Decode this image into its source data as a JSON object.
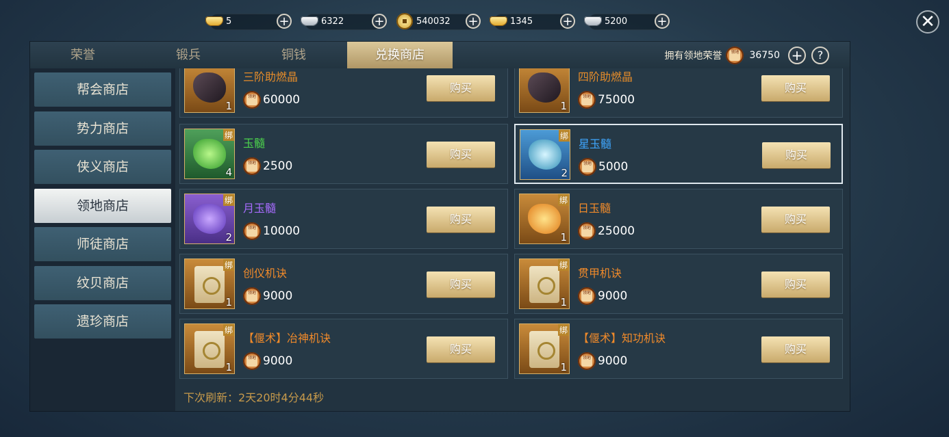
{
  "currencies": [
    {
      "icon": "gold-ingot-icon",
      "value": "5"
    },
    {
      "icon": "silver-ingot-icon",
      "value": "6322"
    },
    {
      "icon": "copper-coin-icon",
      "value": "540032"
    },
    {
      "icon": "bound-gold-ingot-icon",
      "value": "1345"
    },
    {
      "icon": "bound-silver-ingot-icon",
      "value": "5200"
    }
  ],
  "close_label": "✕",
  "tabs": [
    "荣誉",
    "锻兵",
    "铜钱",
    "兑换商店"
  ],
  "active_tab": 3,
  "honor": {
    "label": "拥有领地荣誉",
    "token_text": "领地",
    "value": "36750",
    "plus": "+",
    "help": "?"
  },
  "sidebar": [
    "帮会商店",
    "势力商店",
    "侠义商店",
    "领地商店",
    "师徒商店",
    "纹贝商店",
    "遗珍商店"
  ],
  "active_sidebar": 3,
  "buy_label": "购买",
  "bind_label": "绑",
  "token_text": "领地",
  "items": [
    {
      "name": "三阶助燃晶",
      "price": "60000",
      "qty": "1",
      "bound": false,
      "color": "#e58c2a"
    },
    {
      "name": "四阶助燃晶",
      "price": "75000",
      "qty": "1",
      "bound": false,
      "color": "#e58c2a"
    },
    {
      "name": "玉髓",
      "price": "2500",
      "qty": "4",
      "bound": true,
      "color": "#4cd24c"
    },
    {
      "name": "星玉髓",
      "price": "5000",
      "qty": "2",
      "bound": true,
      "color": "#3fa7ff"
    },
    {
      "name": "月玉髓",
      "price": "10000",
      "qty": "2",
      "bound": true,
      "color": "#a86cff"
    },
    {
      "name": "日玉髓",
      "price": "25000",
      "qty": "1",
      "bound": true,
      "color": "#f08a2a"
    },
    {
      "name": "创仪机诀",
      "price": "9000",
      "qty": "1",
      "bound": true,
      "color": "#f08a2a"
    },
    {
      "name": "贯甲机诀",
      "price": "9000",
      "qty": "1",
      "bound": true,
      "color": "#f08a2a"
    },
    {
      "name": "【偃术】冶神机诀",
      "price": "9000",
      "qty": "1",
      "bound": true,
      "color": "#f08a2a"
    },
    {
      "name": "【偃术】知功机诀",
      "price": "9000",
      "qty": "1",
      "bound": true,
      "color": "#f08a2a"
    }
  ],
  "selected_item": 3,
  "refresh_text": "下次刷新：2天20时4分44秒"
}
